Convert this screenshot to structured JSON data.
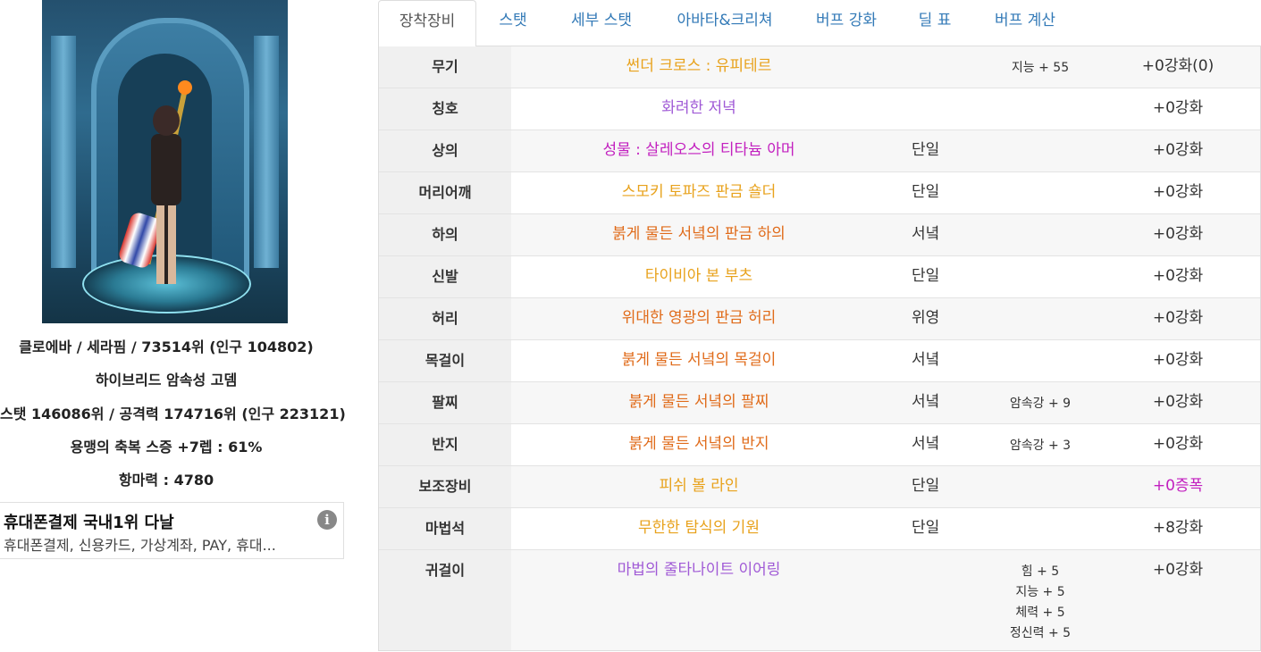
{
  "character": {
    "line1": "클로에바 / 세라핌 / 73514위 (인구 104802)",
    "line2": "하이브리드 암속성 고뎀",
    "line3": "스탯 146086위 / 공격력 174716위 (인구 223121)",
    "line4": "용맹의 축복 스증 +7렙 : 61%",
    "line5": "항마력 : 4780"
  },
  "ad": {
    "title": "휴대폰결제 국내1위 다날",
    "desc": "휴대폰결제, 신용카드, 가상계좌, PAY, 휴대...",
    "info_icon": "i"
  },
  "tabs": [
    "장착장비",
    "스탯",
    "세부 스탯",
    "아바타&크리쳐",
    "버프 강화",
    "딜 표",
    "버프 계산"
  ],
  "equipment": [
    {
      "slot": "무기",
      "name": "썬더 크로스 : 유피테르",
      "color": "#e8a21c",
      "set": "",
      "stats": [
        "지능 + 55"
      ],
      "reinforce": "+0강화(0)"
    },
    {
      "slot": "칭호",
      "name": "화려한 저녁",
      "color": "#a05ad6",
      "set": "",
      "stats": [],
      "reinforce": "+0강화"
    },
    {
      "slot": "상의",
      "name": "성물 : 살레오스의 티타늄 아머",
      "color": "#c21fbf",
      "set": "단일",
      "stats": [],
      "reinforce": "+0강화"
    },
    {
      "slot": "머리어깨",
      "name": "스모키 토파즈 판금 숄더",
      "color": "#e8a21c",
      "set": "단일",
      "stats": [],
      "reinforce": "+0강화"
    },
    {
      "slot": "하의",
      "name": "붉게 물든 서녘의 판금 하의",
      "color": "#e06b1a",
      "set": "서녘",
      "stats": [],
      "reinforce": "+0강화"
    },
    {
      "slot": "신발",
      "name": "타이비아 본 부츠",
      "color": "#e8a21c",
      "set": "단일",
      "stats": [],
      "reinforce": "+0강화"
    },
    {
      "slot": "허리",
      "name": "위대한 영광의 판금 허리",
      "color": "#e06b1a",
      "set": "위영",
      "stats": [],
      "reinforce": "+0강화"
    },
    {
      "slot": "목걸이",
      "name": "붉게 물든 서녘의 목걸이",
      "color": "#e06b1a",
      "set": "서녘",
      "stats": [],
      "reinforce": "+0강화"
    },
    {
      "slot": "팔찌",
      "name": "붉게 물든 서녘의 팔찌",
      "color": "#e06b1a",
      "set": "서녘",
      "stats": [
        "암속강 + 9"
      ],
      "reinforce": "+0강화"
    },
    {
      "slot": "반지",
      "name": "붉게 물든 서녘의 반지",
      "color": "#e06b1a",
      "set": "서녘",
      "stats": [
        "암속강 + 3"
      ],
      "reinforce": "+0강화"
    },
    {
      "slot": "보조장비",
      "name": "피쉬 볼 라인",
      "color": "#e8a21c",
      "set": "단일",
      "stats": [],
      "reinforce": "+0증폭",
      "reinforce_color": "#c21fbf"
    },
    {
      "slot": "마법석",
      "name": "무한한 탐식의 기원",
      "color": "#e8a21c",
      "set": "단일",
      "stats": [],
      "reinforce": "+8강화"
    },
    {
      "slot": "귀걸이",
      "name": "마법의 줄타나이트 이어링",
      "color": "#a05ad6",
      "set": "",
      "stats": [
        "힘 + 5",
        "지능 + 5",
        "체력 + 5",
        "정신력 + 5"
      ],
      "reinforce": "+0강화"
    }
  ]
}
